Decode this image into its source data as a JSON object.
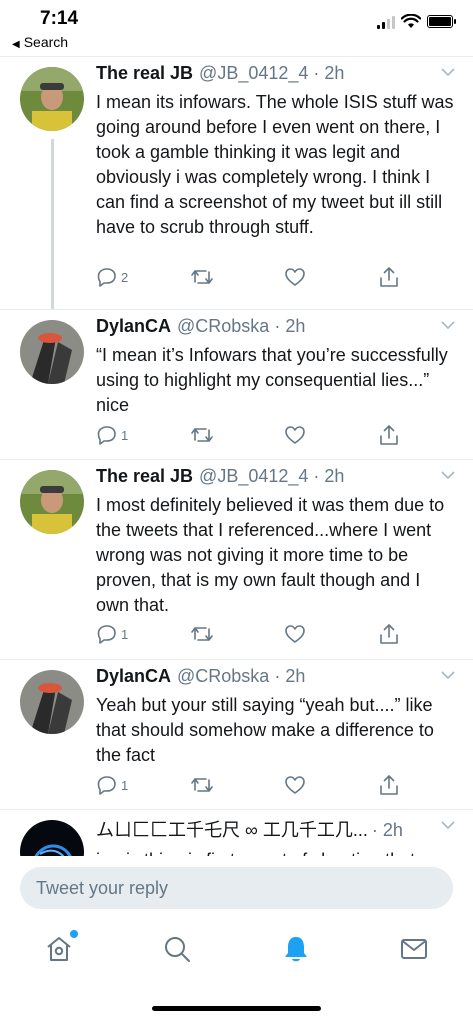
{
  "status_bar": {
    "time": "7:14",
    "back_label": "Search"
  },
  "tweets": [
    {
      "display_name": "The real JB",
      "handle": "@JB_0412_4",
      "time": "2h",
      "text": "I mean its infowars. The whole ISIS stuff was going around before I even went on there, I took a gamble thinking it was legit and obviously i was completely wrong. I think I can find a screenshot of my tweet but ill still have to scrub through stuff.",
      "reply_count": "2",
      "avatar": "jb"
    },
    {
      "display_name": "DylanCA",
      "handle": "@CRobska",
      "time": "2h",
      "text": "“I mean it’s Infowars that you’re successfully using to highlight my consequential lies...” nice",
      "reply_count": "1",
      "avatar": "dylan"
    },
    {
      "display_name": "The real JB",
      "handle": "@JB_0412_4",
      "time": "2h",
      "text": "I most definitely believed it was them due to the tweets that I referenced...where I went wrong was not giving it more time to be proven, that is my own fault though and I own that.",
      "reply_count": "1",
      "avatar": "jb"
    },
    {
      "display_name": "DylanCA",
      "handle": "@CRobska",
      "time": "2h",
      "text": "Yeah but your still saying “yeah but....” like that should somehow make a difference to the fact",
      "reply_count": "1",
      "avatar": "dylan"
    },
    {
      "display_name": "ムㄩ匚匚工千乇尺 ∞ 工几千工几...",
      "handle": "",
      "time": "2h",
      "text": "ironic thing is first report of shooting that",
      "reply_count": "",
      "avatar": "blue"
    }
  ],
  "reply": {
    "placeholder": "Tweet your reply"
  },
  "tabs": [
    "home-icon",
    "search-icon",
    "notifications-icon",
    "messages-icon"
  ],
  "colors": {
    "accent": "#1da1f2",
    "muted": "#657786",
    "divider": "#e6ecf0",
    "reply_bg": "#e6ecf0"
  }
}
